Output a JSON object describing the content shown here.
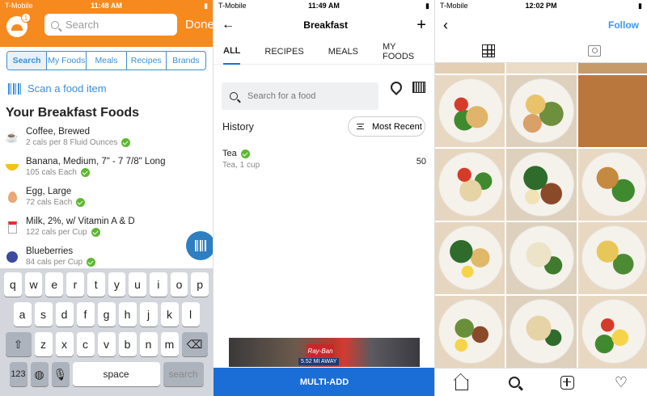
{
  "left": {
    "status": {
      "carrier": "T-Mobile",
      "time": "11:48 AM"
    },
    "logo_badge": "1",
    "search_placeholder": "Search",
    "done": "Done",
    "tabs": [
      "Search",
      "My Foods",
      "Meals",
      "Recipes",
      "Brands"
    ],
    "scan_label": "Scan a food item",
    "section_title": "Your Breakfast Foods",
    "foods": [
      {
        "name": "Coffee, Brewed",
        "desc": "2 cals per 8 Fluid Ounces",
        "icon": "coffee-icon"
      },
      {
        "name": "Banana, Medium, 7\" - 7 7/8\" Long",
        "desc": "105 cals Each",
        "icon": "banana-icon"
      },
      {
        "name": "Egg, Large",
        "desc": "72 cals Each",
        "icon": "egg-icon"
      },
      {
        "name": "Milk, 2%, w/ Vitamin A & D",
        "desc": "122 cals per Cup",
        "icon": "milk-icon"
      },
      {
        "name": "Blueberries",
        "desc": "84 cals per Cup",
        "icon": "blueberry-icon"
      }
    ],
    "keyboard": {
      "row1": [
        "q",
        "w",
        "e",
        "r",
        "t",
        "y",
        "u",
        "i",
        "o",
        "p"
      ],
      "row2": [
        "a",
        "s",
        "d",
        "f",
        "g",
        "h",
        "j",
        "k",
        "l"
      ],
      "row3": [
        "z",
        "x",
        "c",
        "v",
        "b",
        "n",
        "m"
      ],
      "num": "123",
      "space": "space",
      "search": "search"
    },
    "accent": "#f68a1f"
  },
  "middle": {
    "status": {
      "carrier": "T-Mobile",
      "time": "11:49 AM"
    },
    "title": "Breakfast",
    "tabs": [
      "ALL",
      "RECIPES",
      "MEALS",
      "MY FOODS"
    ],
    "search_placeholder": "Search for a food",
    "history_label": "History",
    "sort_label": "Most Recent",
    "history": [
      {
        "name": "Tea",
        "desc": "Tea, 1 cup",
        "cal": "50"
      }
    ],
    "ad": {
      "mi_away": "5.52 MI AWAY"
    },
    "multi_add": "MULTI-ADD",
    "accent": "#1b6ed6"
  },
  "right": {
    "status": {
      "carrier": "T-Mobile",
      "time": "12:02 PM"
    },
    "follow": "Follow",
    "accent": "#3897f0"
  }
}
